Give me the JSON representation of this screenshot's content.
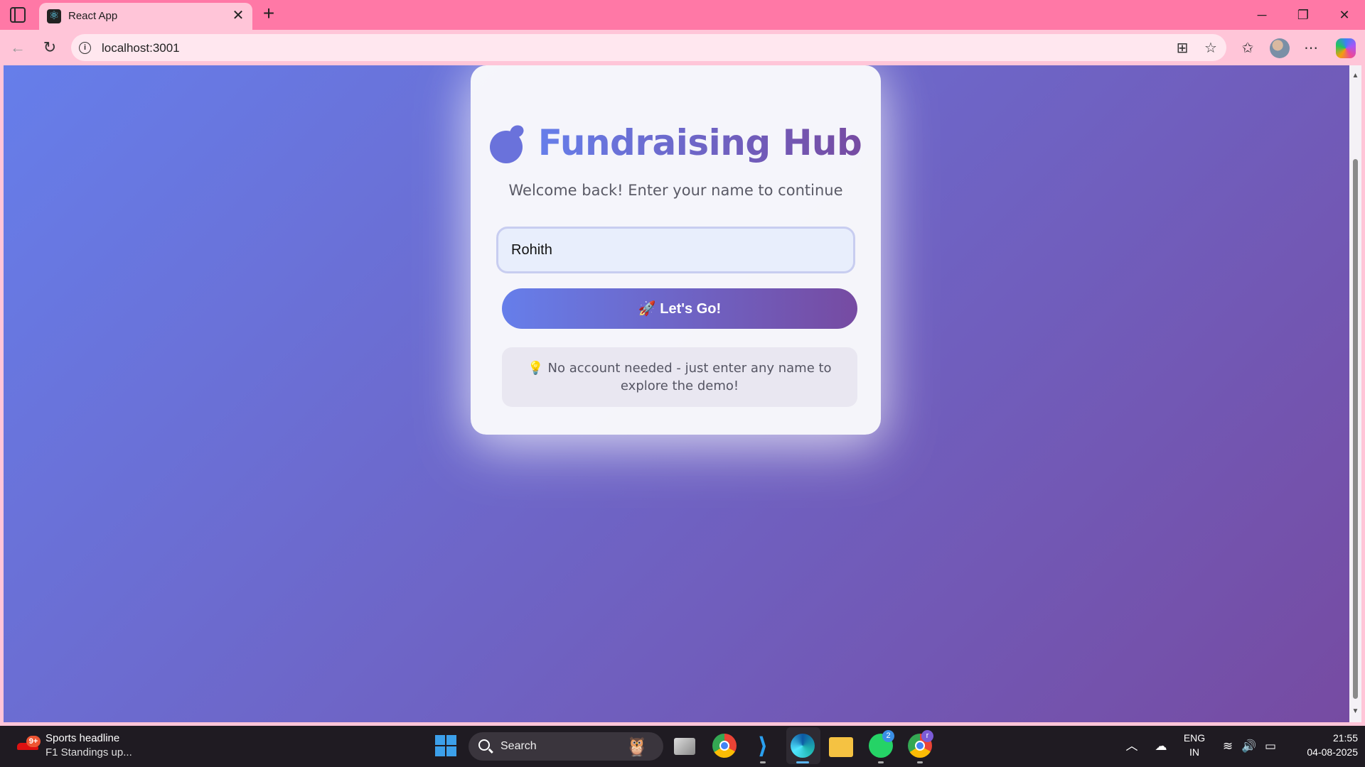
{
  "browser": {
    "tab_title": "React App",
    "tab_close": "✕",
    "new_tab": "+",
    "url": "localhost:3001",
    "info_glyph": "i",
    "window_controls": {
      "minimize": "─",
      "restore": "❐",
      "close": "✕"
    }
  },
  "page": {
    "brand_title": "Fundraising Hub",
    "subtitle": "Welcome back! Enter your name to continue",
    "name_input": {
      "value": "Rohith",
      "placeholder": ""
    },
    "go_button_label": "🚀 Let's Go!",
    "hint": "💡 No account needed - just enter any name to explore the demo!"
  },
  "colors": {
    "gradient_start": "#667eea",
    "gradient_end": "#764ba2",
    "browser_tabbar": "#ff78a6",
    "browser_toolbar": "#ffc5d8"
  },
  "taskbar": {
    "news_badge": "9+",
    "news_title": "Sports headline",
    "news_subtitle": "F1 Standings up...",
    "search_label": "Search",
    "whatsapp_badge": "2",
    "chrome_profile_badge": "r",
    "language_line1": "ENG",
    "language_line2": "IN",
    "time": "21:55",
    "date": "04-08-2025"
  }
}
